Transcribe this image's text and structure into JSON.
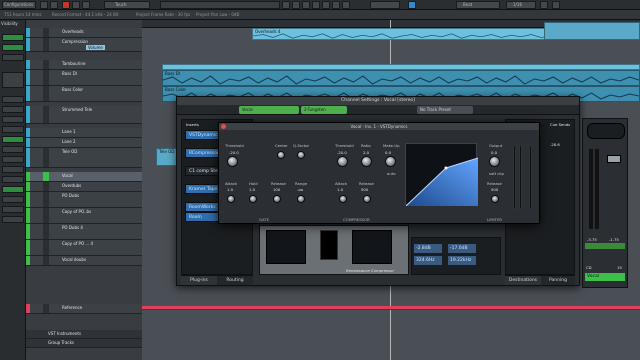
{
  "toolbar": {
    "configurations": "Configurations",
    "mode": "Touch",
    "snap": "Beat",
    "quantize": "1/16"
  },
  "infoline": {
    "items": [
      "751 hours 14 mins",
      "Record Format - 44.1 kHz - 24 Bit",
      "Project Frame Rate - 30 fps",
      "Project Pan Law - 0dB"
    ]
  },
  "left_zone": {
    "title": "Visibility"
  },
  "tracks": [
    {
      "name": "Overheads",
      "color": "#3aa6c8"
    },
    {
      "name": "Compression",
      "color": "#3aa6c8",
      "sub": "Volume"
    },
    {
      "name": "Tambourine",
      "color": "#3aa6c8"
    },
    {
      "name": "Bass DI",
      "color": "#3aa6c8"
    },
    {
      "name": "Bass Color",
      "color": "#3aa6c8"
    },
    {
      "name": "Strummed Tele",
      "color": "#3aa6c8"
    },
    {
      "name": "Lane 1",
      "color": "#3aa6c8"
    },
    {
      "name": "Lane 2",
      "color": "#3aa6c8"
    },
    {
      "name": "Tele OD",
      "color": "#3aa6c8"
    },
    {
      "name": "Vocal",
      "color": "#3cc04a"
    },
    {
      "name": "Overdubs",
      "color": "#3cc04a"
    },
    {
      "name": "PO Dubs",
      "color": "#3cc04a"
    },
    {
      "name": "Copy of PO..bs",
      "color": "#3cc04a"
    },
    {
      "name": "PO Dubs 4",
      "color": "#3cc04a"
    },
    {
      "name": "Copy of PO ... 4",
      "color": "#3cc04a"
    },
    {
      "name": "Vocal doubs",
      "color": "#3cc04a"
    },
    {
      "name": "Reference",
      "color": "#e0405a"
    },
    {
      "name": "VST Instruments",
      "color": "#8a8f94"
    },
    {
      "name": "Group Tracks",
      "color": "#8a8f94"
    }
  ],
  "events": {
    "overheads": "Overheads 4",
    "bass": "Bass DI",
    "bass_color": "Bass Color",
    "tele": "Tele OD"
  },
  "channel_settings": {
    "title": "Channel Settings : Vocal  [stereo]",
    "channel_name": "Vocal",
    "routing_target": "2-Tungsten",
    "preset": "No Track Preset",
    "inserts_label": "Inserts",
    "inserts": [
      "VSTDynamics",
      "RCompressor",
      "C1 comp Stereo",
      "Kramer Tape Stereo",
      "RoomWorks",
      "Room"
    ],
    "sends_label": "Cue Sends",
    "stereo_label": "Stereo",
    "stereo_value": "-28.6",
    "tabs": [
      "Plug-ins",
      "Routing",
      "Destinations",
      "Panning"
    ],
    "readouts": [
      "-2.8dB",
      "-17.0dB",
      "324.6Hz",
      "19.22kHz"
    ],
    "rcomp_name": "Renaissance Compressor"
  },
  "plugin": {
    "title": "Vocal - Ins. 1 - VSTDynamics",
    "gate": {
      "threshold_label": "Threshold",
      "threshold": "-20.0",
      "attack_label": "Attack",
      "attack": "1.0",
      "hold_label": "Hold",
      "hold": "1.0",
      "release_label": "Release",
      "release": "100",
      "range_label": "Range",
      "range": "-oo",
      "center_label": "Center",
      "qfactor_label": "Q-Factor",
      "name": "GATE"
    },
    "compressor": {
      "threshold_label": "Threshold",
      "threshold": "-20.0",
      "ratio_label": "Ratio",
      "ratio": "2.0",
      "makeup_label": "Make-Up",
      "makeup": "0.0",
      "attack_label": "Attack",
      "attack": "1.0",
      "release_label": "Release",
      "release": "500",
      "name": "COMPRESSOR",
      "auto": "auto"
    },
    "limiter": {
      "output_label": "Output",
      "output": "0.0",
      "release_label": "Release",
      "release": "500",
      "name": "LIMITER",
      "soft_clip": "soft clip"
    }
  },
  "channel_strip": {
    "value_left": "-3.75",
    "value_right": "-1.75",
    "bottom_left": "CD",
    "bottom_right": "19",
    "name": "Vocal"
  }
}
